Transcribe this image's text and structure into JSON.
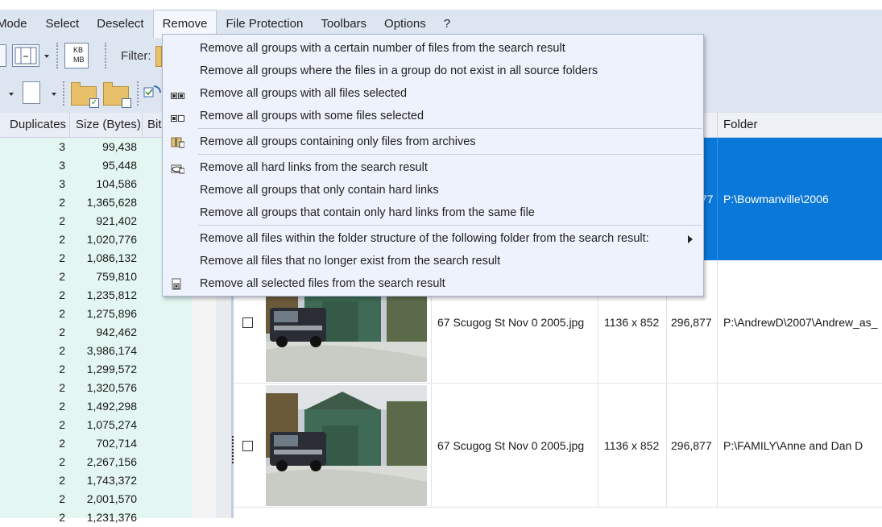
{
  "menubar": {
    "items": [
      {
        "label": "Mode",
        "display": "Mode"
      },
      {
        "label": "Select"
      },
      {
        "label": "Deselect"
      },
      {
        "label": "Remove"
      },
      {
        "label": "File Protection"
      },
      {
        "label": "Toolbars"
      },
      {
        "label": "Options"
      },
      {
        "label": "?"
      }
    ]
  },
  "toolbar": {
    "filter_label": "Filter:",
    "kb_label_top": "KB",
    "kb_label_bottom": "MB"
  },
  "left_table": {
    "headers": [
      "Duplicates",
      "Size (Bytes)",
      "Bit"
    ],
    "rows": [
      {
        "dup": "3",
        "size": "99,438"
      },
      {
        "dup": "3",
        "size": "95,448"
      },
      {
        "dup": "3",
        "size": "104,586"
      },
      {
        "dup": "2",
        "size": "1,365,628"
      },
      {
        "dup": "2",
        "size": "921,402"
      },
      {
        "dup": "2",
        "size": "1,020,776"
      },
      {
        "dup": "2",
        "size": "1,086,132"
      },
      {
        "dup": "2",
        "size": "759,810"
      },
      {
        "dup": "2",
        "size": "1,235,812"
      },
      {
        "dup": "2",
        "size": "1,275,896"
      },
      {
        "dup": "2",
        "size": "942,462"
      },
      {
        "dup": "2",
        "size": "3,986,174"
      },
      {
        "dup": "2",
        "size": "1,299,572"
      },
      {
        "dup": "2",
        "size": "1,320,576"
      },
      {
        "dup": "2",
        "size": "1,492,298"
      },
      {
        "dup": "2",
        "size": "1,075,274"
      },
      {
        "dup": "2",
        "size": "702,714"
      },
      {
        "dup": "2",
        "size": "2,267,156"
      },
      {
        "dup": "2",
        "size": "1,743,372"
      },
      {
        "dup": "2",
        "size": "2,001,570"
      },
      {
        "dup": "2",
        "size": "1,231,376"
      }
    ]
  },
  "right_table": {
    "folder_header": "Folder",
    "selected_row": {
      "size_suffix": "77",
      "folder": "P:\\Bowmanville\\2006"
    },
    "rows": [
      {
        "checked": false,
        "name": "67 Scugog St Nov 0 2005.jpg",
        "dimensions": "1136 x 852",
        "size": "296,877",
        "folder": "P:\\AndrewD\\2007\\Andrew_as_"
      },
      {
        "checked": false,
        "name": "67 Scugog St Nov 0 2005.jpg",
        "dimensions": "1136 x 852",
        "size": "296,877",
        "folder": "P:\\FAMILY\\Anne and Dan D"
      }
    ]
  },
  "remove_menu": {
    "items": [
      {
        "label": "Remove all groups with a certain number of files from the search result",
        "icon": "none"
      },
      {
        "label": "Remove all groups where the files in a group do not exist in all source folders",
        "icon": "none"
      },
      {
        "label": "Remove all groups with all files selected",
        "icon": "group-all-selected-icon"
      },
      {
        "label": "Remove all groups with some files selected",
        "icon": "group-some-selected-icon"
      },
      {
        "label": "Remove all groups containing only files from archives",
        "icon": "archive-icon"
      },
      {
        "label": "Remove all hard links from the search result",
        "icon": "hard-link-icon"
      },
      {
        "label": "Remove all groups that only contain hard links",
        "icon": "none"
      },
      {
        "label": "Remove all groups that contain only hard links from the same file",
        "icon": "none"
      },
      {
        "label": "Remove all files within the folder structure of the following folder from the search result:",
        "icon": "none",
        "submenu": true
      },
      {
        "label": "Remove all files that no longer exist from the search result",
        "icon": "none"
      },
      {
        "label": "Remove all selected files from the search result",
        "icon": "remove-selected-icon"
      }
    ]
  },
  "colors": {
    "menubar_bg": "#dde5f1",
    "selection_blue": "#0a78d8",
    "left_panel_bg": "#e3f6f1",
    "dropdown_bg": "#eef2fd"
  }
}
